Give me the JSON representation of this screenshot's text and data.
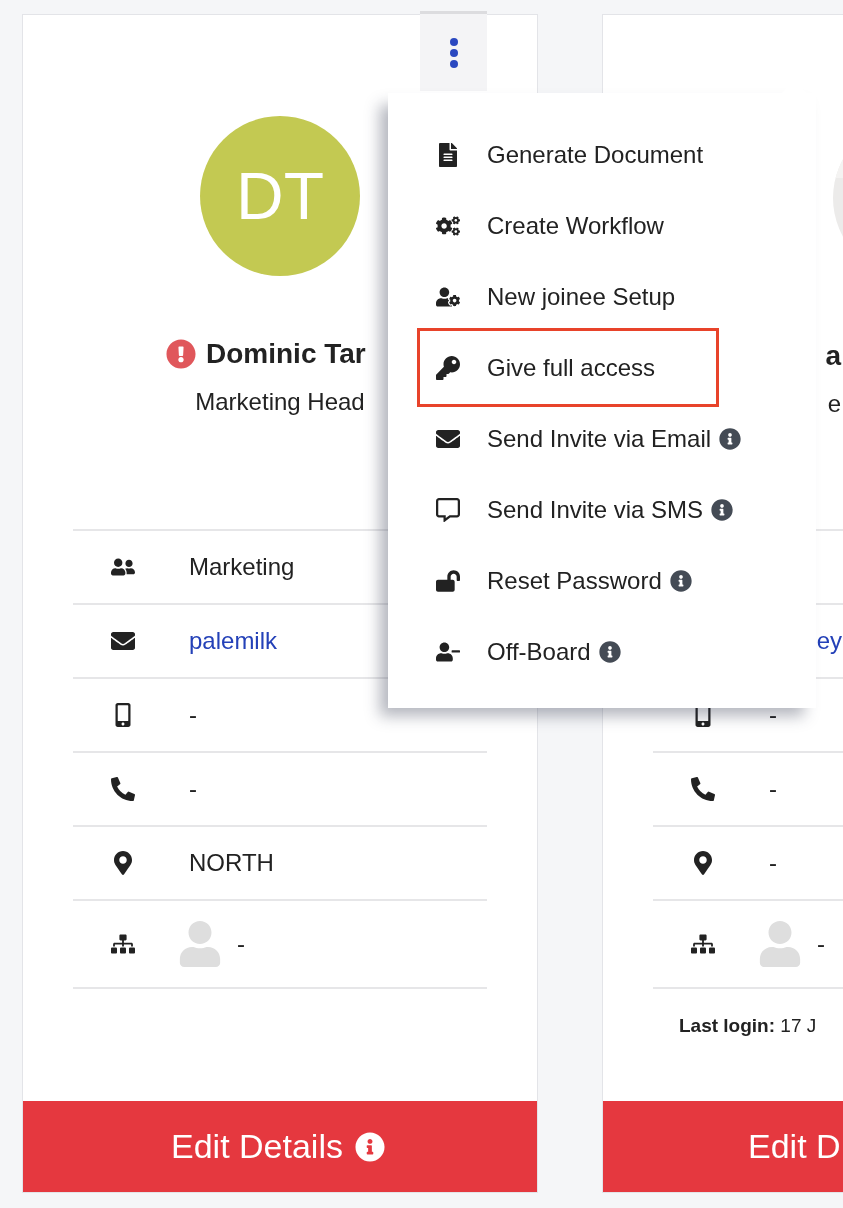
{
  "cards": [
    {
      "avatar": {
        "kind": "initials",
        "initials": "DT",
        "color": "#c3c952"
      },
      "alert": true,
      "name": "Dominic Tar",
      "title": "Marketing Head",
      "details": [
        {
          "kind": "department",
          "value": "Marketing",
          "link": false
        },
        {
          "kind": "email",
          "value": "palemilk",
          "link": true
        },
        {
          "kind": "mobile",
          "value": "-",
          "link": false
        },
        {
          "kind": "phone",
          "value": "-",
          "link": false
        },
        {
          "kind": "location",
          "value": "NORTH",
          "link": false
        },
        {
          "kind": "manager",
          "value": "-",
          "link": false
        }
      ],
      "button": {
        "label": "Edit Details",
        "info": true
      }
    },
    {
      "alert": false,
      "name": "a",
      "title": "e",
      "details": [
        {
          "kind": "blank"
        },
        {
          "kind": "blank",
          "value": "ey",
          "link": true
        },
        {
          "kind": "mobile",
          "value": "-",
          "link": false
        },
        {
          "kind": "phone",
          "value": "-",
          "link": false
        },
        {
          "kind": "location",
          "value": "-",
          "link": false
        },
        {
          "kind": "manager",
          "value": "-",
          "link": false
        }
      ],
      "last_login": "**Last login:** 17 J",
      "button": {
        "label": "Edit D"
      }
    }
  ],
  "menu": {
    "items": [
      {
        "kind": "document",
        "label": "Generate Document",
        "info": false,
        "highlighted": false
      },
      {
        "kind": "workflow",
        "label": "Create Workflow",
        "info": false,
        "highlighted": false
      },
      {
        "kind": "setup",
        "label": "New joinee Setup",
        "info": false,
        "highlighted": false
      },
      {
        "kind": "access",
        "label": "Give full access",
        "info": false,
        "highlighted": true
      },
      {
        "kind": "email",
        "label": "Send Invite via Email",
        "info": true,
        "highlighted": false
      },
      {
        "kind": "sms",
        "label": "Send Invite via SMS",
        "info": true,
        "highlighted": false
      },
      {
        "kind": "password",
        "label": "Reset Password",
        "info": true,
        "highlighted": false
      },
      {
        "kind": "offboard",
        "label": "Off-Board",
        "info": true,
        "highlighted": false
      }
    ]
  }
}
